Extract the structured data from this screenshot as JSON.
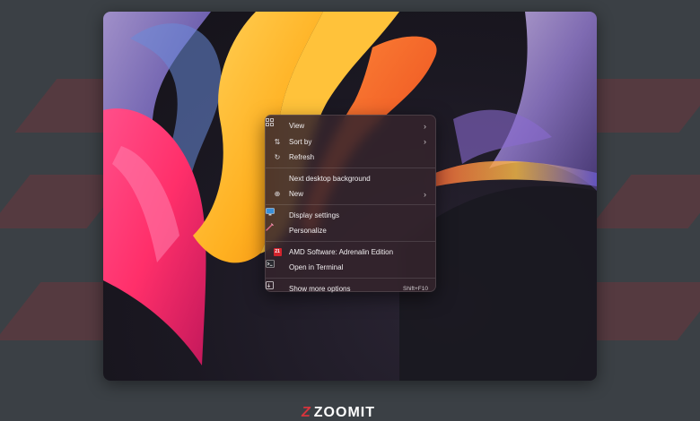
{
  "context_menu": {
    "items": [
      {
        "label": "View",
        "icon": "grid-icon",
        "submenu": true
      },
      {
        "label": "Sort by",
        "icon": "sort-icon",
        "submenu": true
      },
      {
        "label": "Refresh",
        "icon": "refresh-icon",
        "submenu": false
      },
      {
        "label": "Next desktop background",
        "icon": "",
        "submenu": false
      },
      {
        "label": "New",
        "icon": "new-plus-icon",
        "submenu": true
      },
      {
        "label": "Display settings",
        "icon": "display-icon",
        "submenu": false
      },
      {
        "label": "Personalize",
        "icon": "brush-icon",
        "submenu": false
      },
      {
        "label": "AMD Software: Adrenalin Edition",
        "icon": "amd-icon",
        "submenu": false
      },
      {
        "label": "Open in Terminal",
        "icon": "terminal-icon",
        "submenu": false
      },
      {
        "label": "Show more options",
        "icon": "more-options-icon",
        "shortcut": "Shift+F10"
      }
    ]
  },
  "watermark": {
    "text": "ZOOMIT",
    "mark": "Z"
  },
  "colors": {
    "page_bg": "#3b4045",
    "stripe": "#5a3a3f",
    "menu_bg": "#34242c",
    "accent": "#d6343c"
  }
}
